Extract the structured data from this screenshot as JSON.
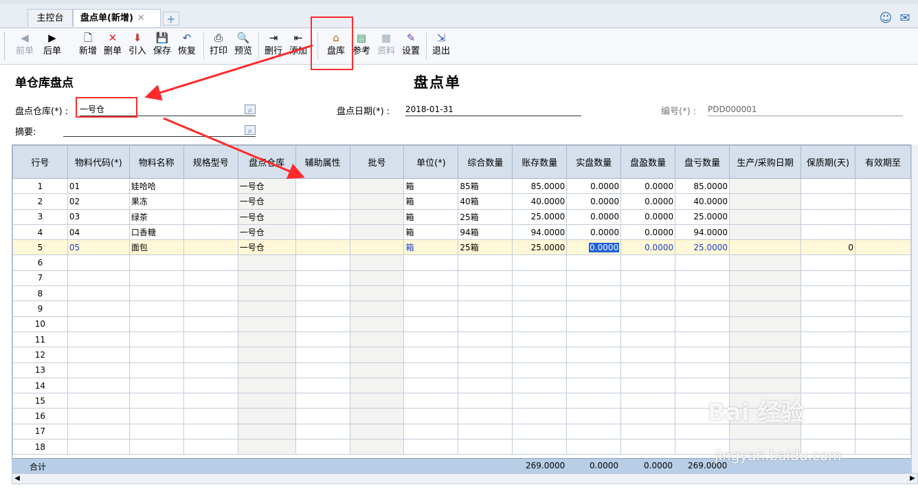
{
  "tabs": [
    {
      "label": "主控台"
    },
    {
      "label": "盘点单(新增)"
    }
  ],
  "toolbar": {
    "buttons": [
      {
        "label": "前单",
        "icon": "◀"
      },
      {
        "label": "后单",
        "icon": "▶"
      },
      {
        "label": "新增",
        "icon": "🗋"
      },
      {
        "label": "删单",
        "icon": "✕"
      },
      {
        "label": "引入",
        "icon": "⬇"
      },
      {
        "label": "保存",
        "icon": "💾"
      },
      {
        "label": "恢复",
        "icon": "↶"
      },
      {
        "label": "打印",
        "icon": "⎙"
      },
      {
        "label": "预览",
        "icon": "🔍"
      },
      {
        "label": "删行",
        "icon": "⇥"
      },
      {
        "label": "添加",
        "icon": "⇤"
      },
      {
        "label": "盘库",
        "icon": "⌂"
      },
      {
        "label": "参考",
        "icon": "▤"
      },
      {
        "label": "资料",
        "icon": "▦"
      },
      {
        "label": "设置",
        "icon": "✎"
      },
      {
        "label": "退出",
        "icon": "⇲"
      }
    ]
  },
  "form": {
    "title_left": "单仓库盘点",
    "title_center": "盘点单",
    "warehouse_label": "盘点仓库(*) :",
    "warehouse_value": "一号仓",
    "date_label": "盘点日期(*) :",
    "date_value": "2018-01-31",
    "number_label": "编号(*) :",
    "number_value": "PDD000001",
    "summary_label": "摘要:"
  },
  "grid": {
    "columns": [
      "行号",
      "物料代码(*)",
      "物料名称",
      "规格型号",
      "盘点仓库",
      "辅助属性",
      "批号",
      "单位(*)",
      "综合数量",
      "账存数量",
      "实盘数量",
      "盘盈数量",
      "盘亏数量",
      "生产/采购日期",
      "保质期(天)",
      "有效期至"
    ],
    "rows": [
      {
        "no": "1",
        "code": "01",
        "name": "娃哈哈",
        "spec": "",
        "wh": "一号仓",
        "aux": "",
        "batch": "",
        "unit": "箱",
        "combo": "85箱",
        "book": "85.0000",
        "actual": "0.0000",
        "gain": "0.0000",
        "loss": "85.0000",
        "date": "",
        "shelf": "",
        "expiry": ""
      },
      {
        "no": "2",
        "code": "02",
        "name": "果冻",
        "spec": "",
        "wh": "一号仓",
        "aux": "",
        "batch": "",
        "unit": "箱",
        "combo": "40箱",
        "book": "40.0000",
        "actual": "0.0000",
        "gain": "0.0000",
        "loss": "40.0000",
        "date": "",
        "shelf": "",
        "expiry": ""
      },
      {
        "no": "3",
        "code": "03",
        "name": "绿茶",
        "spec": "",
        "wh": "一号仓",
        "aux": "",
        "batch": "",
        "unit": "箱",
        "combo": "25箱",
        "book": "25.0000",
        "actual": "0.0000",
        "gain": "0.0000",
        "loss": "25.0000",
        "date": "",
        "shelf": "",
        "expiry": ""
      },
      {
        "no": "4",
        "code": "04",
        "name": "口香糖",
        "spec": "",
        "wh": "一号仓",
        "aux": "",
        "batch": "",
        "unit": "箱",
        "combo": "94箱",
        "book": "94.0000",
        "actual": "0.0000",
        "gain": "0.0000",
        "loss": "94.0000",
        "date": "",
        "shelf": "",
        "expiry": ""
      },
      {
        "no": "5",
        "code": "05",
        "name": "面包",
        "spec": "",
        "wh": "一号仓",
        "aux": "",
        "batch": "",
        "unit": "箱",
        "combo": "25箱",
        "book": "25.0000",
        "actual": "0.0000",
        "gain": "0.0000",
        "loss": "25.0000",
        "date": "",
        "shelf": "0",
        "expiry": ""
      }
    ],
    "empty_row_numbers": [
      "6",
      "7",
      "8",
      "9",
      "10",
      "11",
      "12",
      "13",
      "14",
      "15",
      "16",
      "17",
      "18"
    ],
    "total_label": "合计",
    "total_book": "269.0000",
    "total_actual": "0.0000",
    "total_gain": "0.0000",
    "total_loss": "269.0000"
  },
  "watermark": {
    "brand": "Bai 经验",
    "url": "jingyan.baidu.com"
  },
  "colors": {
    "annotation_red": "#ff2a2a",
    "header_bg": "#d6e0ec",
    "selected_row": "#fff8d8",
    "total_bar": "#b8cde6"
  }
}
